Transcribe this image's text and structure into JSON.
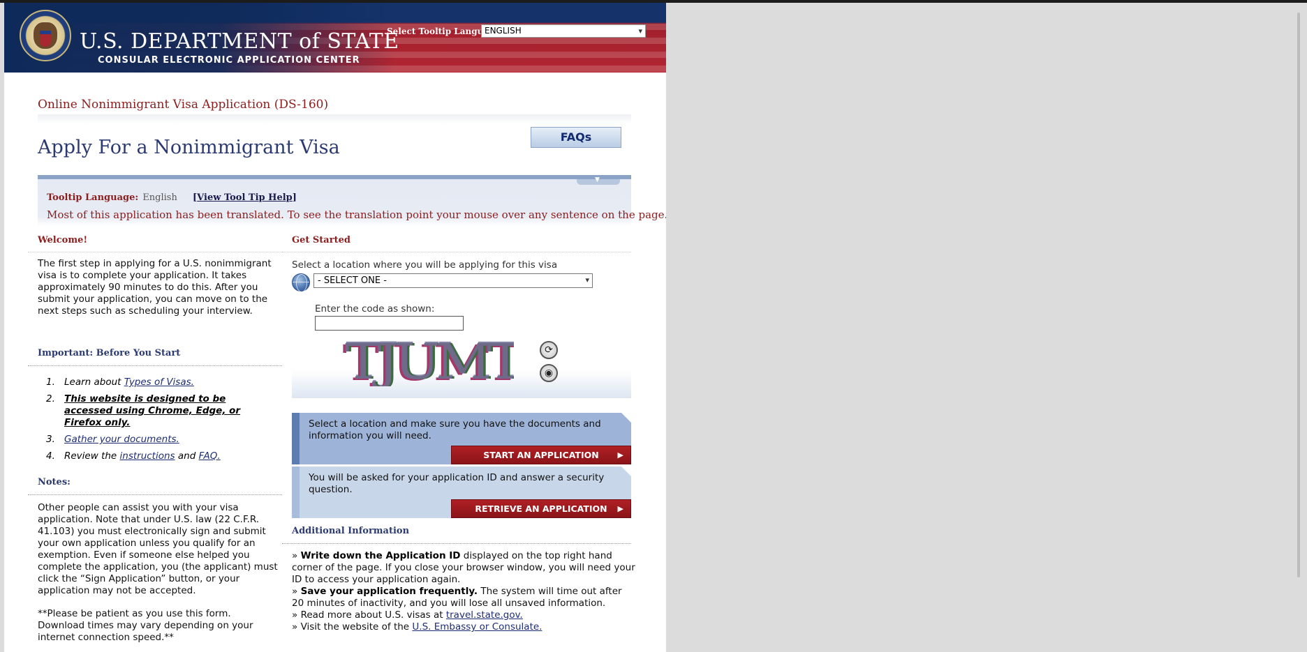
{
  "header": {
    "title_prefix": "U.S. D",
    "title": "U.S. DEPARTMENT of STATE",
    "subtitle": "CONSULAR ELECTRONIC APPLICATION CENTER",
    "tooltip_language_label": "Select Tooltip Language",
    "tooltip_language_value": "ENGLISH"
  },
  "page": {
    "subtitle": "Online Nonimmigrant Visa Application (DS-160)",
    "title": "Apply For a Nonimmigrant Visa",
    "faq_label": "FAQs"
  },
  "translation": {
    "label": "Tooltip Language:",
    "value": "English",
    "help_link": "View Tool Tip Help",
    "message": "Most of this application has been translated. To see the translation point your mouse over any sentence on the page."
  },
  "welcome": {
    "heading": "Welcome!",
    "text": "The first step in applying for a U.S. nonimmigrant visa is to complete your application. It takes approximately 90 minutes to do this. After you submit your application, you can move on to the next steps such as scheduling your interview."
  },
  "important": {
    "heading": "Important: Before You Start",
    "items": [
      {
        "num": "1.",
        "pre": "Learn about ",
        "link": "Types of Visas."
      },
      {
        "num": "2.",
        "text": "This website is designed to be accessed using Chrome, Edge, or Firefox only."
      },
      {
        "num": "3.",
        "link": "Gather your documents."
      },
      {
        "num": "4.",
        "pre": "Review the ",
        "link": "instructions",
        "mid": " and ",
        "link2": "FAQ."
      }
    ]
  },
  "notes": {
    "heading": "Notes:",
    "text": "Other people can assist you with your visa application. Note that under U.S. law (22 C.F.R. 41.103) you must electronically sign and submit your own application unless you qualify for an exemption. Even if someone else helped you complete the application, you (the applicant) must click the “Sign Application” button, or your application may not be accepted.",
    "patience": "**Please be patient as you use this form. Download times may vary depending on your internet connection speed.**"
  },
  "get_started": {
    "heading": "Get Started",
    "location_label": "Select a location where you will be applying for this visa",
    "location_value": "- SELECT ONE -",
    "code_label": "Enter the code as shown:",
    "code_value": "",
    "captcha_text": "TJUMT",
    "refresh_icon": "refresh-icon",
    "audio_icon": "audio-icon"
  },
  "actions": {
    "start_text": "Select a location and make sure you have the documents and information you will need.",
    "start_button": "START AN APPLICATION",
    "retrieve_text": "You will be asked for your application ID and answer a security question.",
    "retrieve_button": "RETRIEVE AN APPLICATION"
  },
  "additional": {
    "heading": "Additional Information",
    "items": [
      {
        "bullet": "» ",
        "bold": "Write down the Application ID",
        "text": " displayed on the top right hand corner of the page. If you close your browser window, you will need your ID to access your application again."
      },
      {
        "bullet": "» ",
        "bold": "Save your application frequently.",
        "text": " The system will time out after 20 minutes of inactivity, and you will lose all unsaved information."
      },
      {
        "bullet": "» ",
        "pre": "Read more about U.S. visas at ",
        "link": "travel.state.gov."
      },
      {
        "bullet": "» ",
        "pre": "Visit the website of the ",
        "link": "U.S. Embassy or Consulate."
      }
    ]
  },
  "colors": {
    "accent_red": "#8b1d1d",
    "title_blue": "#2b3b72",
    "button_red": "#a01c20",
    "panel_blue": "#9db4d8"
  }
}
